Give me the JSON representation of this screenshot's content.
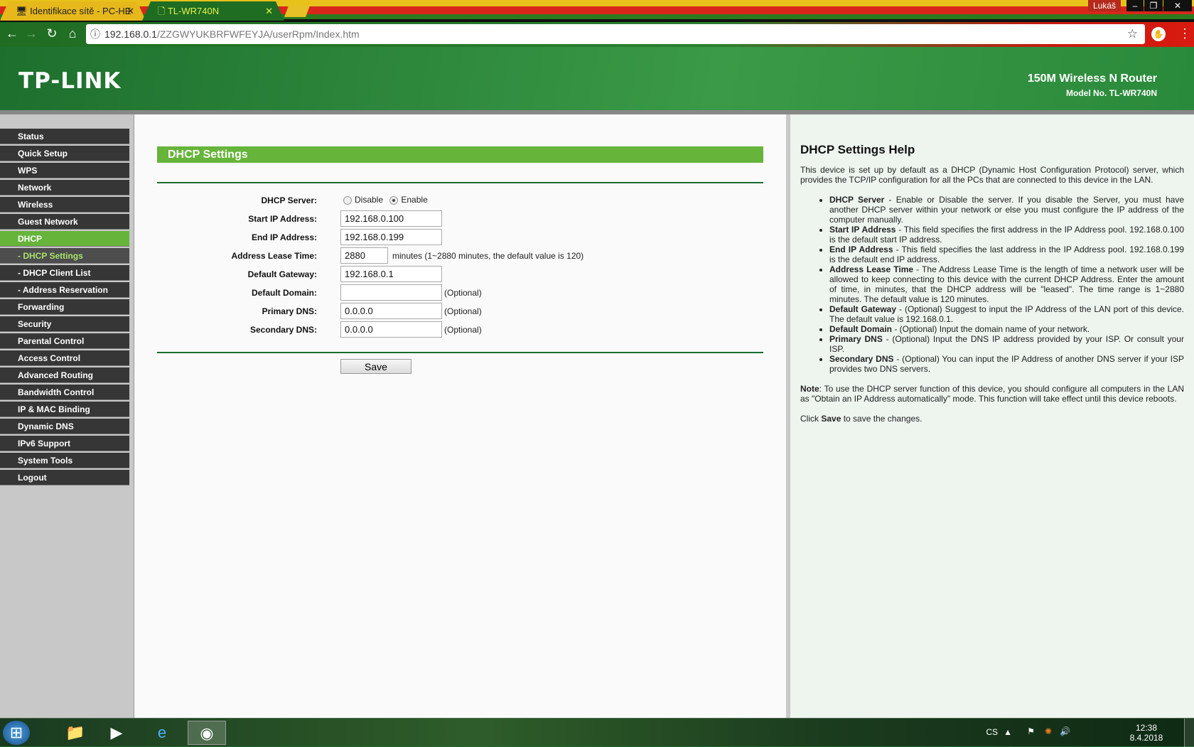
{
  "browser": {
    "tabs": [
      {
        "label": "Identifikace sítě - PC-HE",
        "icon": "computer-icon"
      },
      {
        "label": "TL-WR740N",
        "icon": "page-icon",
        "active": true
      }
    ],
    "user": "Lukáš",
    "url_host": "192.168.0.1",
    "url_path": "/ZZGWYUKBRFWFEYJA/userRpm/Index.htm"
  },
  "header": {
    "logo": "TP-LINK",
    "product": "150M Wireless N Router",
    "model": "Model No. TL-WR740N"
  },
  "sidebar": {
    "items": [
      {
        "label": "Status"
      },
      {
        "label": "Quick Setup"
      },
      {
        "label": "WPS"
      },
      {
        "label": "Network"
      },
      {
        "label": "Wireless"
      },
      {
        "label": "Guest Network"
      },
      {
        "label": "DHCP",
        "state": "active"
      },
      {
        "label": "- DHCP Settings",
        "state": "subactive"
      },
      {
        "label": "- DHCP Client List",
        "state": "sub"
      },
      {
        "label": "- Address Reservation",
        "state": "sub"
      },
      {
        "label": "Forwarding"
      },
      {
        "label": "Security"
      },
      {
        "label": "Parental Control"
      },
      {
        "label": "Access Control"
      },
      {
        "label": "Advanced Routing"
      },
      {
        "label": "Bandwidth Control"
      },
      {
        "label": "IP & MAC Binding"
      },
      {
        "label": "Dynamic DNS"
      },
      {
        "label": "IPv6 Support"
      },
      {
        "label": "System Tools"
      },
      {
        "label": "Logout"
      }
    ]
  },
  "form": {
    "title": "DHCP Settings",
    "dhcp_server_label": "DHCP Server:",
    "disable_label": "Disable",
    "enable_label": "Enable",
    "dhcp_server_value": "Enable",
    "start_ip_label": "Start IP Address:",
    "start_ip": "192.168.0.100",
    "end_ip_label": "End IP Address:",
    "end_ip": "192.168.0.199",
    "lease_label": "Address Lease Time:",
    "lease": "2880",
    "lease_note": "minutes (1~2880 minutes, the default value is 120)",
    "gateway_label": "Default Gateway:",
    "gateway": "192.168.0.1",
    "domain_label": "Default Domain:",
    "domain": "",
    "pdns_label": "Primary DNS:",
    "pdns": "0.0.0.0",
    "sdns_label": "Secondary DNS:",
    "sdns": "0.0.0.0",
    "optional": "(Optional)",
    "save": "Save"
  },
  "help": {
    "title": "DHCP Settings Help",
    "intro": "This device is set up by default as a DHCP (Dynamic Host Configuration Protocol) server, which provides the TCP/IP configuration for all the PCs that are connected to this device in the LAN.",
    "items": [
      {
        "term": "DHCP Server",
        "text": " - Enable or Disable the server. If you disable the Server, you must have another DHCP server within your network or else you must configure the IP address of the computer manually."
      },
      {
        "term": "Start IP Address",
        "text": " - This field specifies the first address in the IP Address pool. 192.168.0.100 is the default start IP address."
      },
      {
        "term": "End IP Address",
        "text": " - This field specifies the last address in the IP Address pool. 192.168.0.199 is the default end IP address."
      },
      {
        "term": "Address Lease Time",
        "text": " - The Address Lease Time is the length of time a network user will be allowed to keep connecting to this device with the current DHCP Address. Enter the amount of time, in minutes, that the DHCP address will be \"leased\". The time range is 1~2880 minutes. The default value is 120 minutes."
      },
      {
        "term": "Default Gateway",
        "text": " - (Optional) Suggest to input the IP Address of the LAN port of this device. The default value is 192.168.0.1."
      },
      {
        "term": "Default Domain",
        "text": " - (Optional) Input the domain name of your network."
      },
      {
        "term": "Primary DNS",
        "text": " - (Optional) Input the DNS IP address provided by your ISP. Or consult your ISP."
      },
      {
        "term": "Secondary DNS",
        "text": " - (Optional) You can input the IP Address of another DNS server if your ISP provides two DNS servers."
      }
    ],
    "note_term": "Note",
    "note_text": ": To use the DHCP server function of this device, you should configure all computers in the LAN as \"Obtain an IP Address automatically\" mode. This function will take effect until this device reboots.",
    "click_pre": "Click ",
    "click_term": "Save",
    "click_post": " to save the changes."
  },
  "taskbar": {
    "lang": "CS",
    "time": "12:38",
    "date": "8.4.2018"
  },
  "colors": {
    "accent_green": "#66b43a",
    "sidebar_dark": "#363636",
    "header_green": "#2a8a3b"
  }
}
